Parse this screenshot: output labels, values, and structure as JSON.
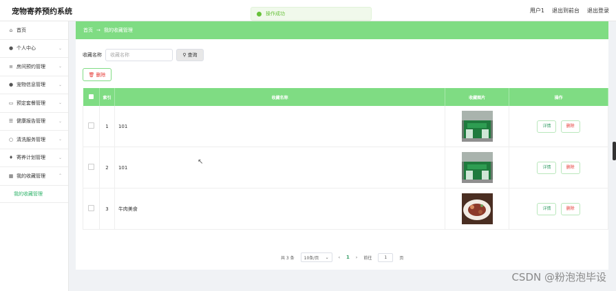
{
  "header": {
    "app_title": "宠物寄养预约系统",
    "user": "用户1",
    "back_to_front": "退出到前台",
    "logout": "退出登录"
  },
  "toast": {
    "message": "操作成功"
  },
  "sidebar": {
    "items": [
      {
        "label": "首页",
        "icon": "home-icon"
      },
      {
        "label": "个人中心",
        "icon": "user-icon"
      },
      {
        "label": "房间预约管理",
        "icon": "list-icon"
      },
      {
        "label": "宠物信息管理",
        "icon": "user-icon"
      },
      {
        "label": "预定套餐管理",
        "icon": "chat-icon"
      },
      {
        "label": "健康报告管理",
        "icon": "sliders-icon"
      },
      {
        "label": "清洗服务管理",
        "icon": "clock-icon"
      },
      {
        "label": "寄养计划管理",
        "icon": "location-icon"
      },
      {
        "label": "我的收藏管理",
        "icon": "grid-icon"
      }
    ],
    "sub_item": "我的收藏管理"
  },
  "breadcrumb": {
    "home": "首页",
    "arrow": "→",
    "current": "我的收藏管理"
  },
  "search": {
    "label": "收藏名称",
    "placeholder": "收藏名称",
    "button": "查询"
  },
  "toolbar": {
    "delete_label": "删除"
  },
  "table": {
    "headers": {
      "index": "索引",
      "name": "收藏名称",
      "image": "收藏图片",
      "ops": "操作"
    },
    "rows": [
      {
        "index": "1",
        "name": "101",
        "image": "storefront"
      },
      {
        "index": "2",
        "name": "101",
        "image": "storefront"
      },
      {
        "index": "3",
        "name": "牛肉美食",
        "image": "food"
      }
    ],
    "detail_label": "详情",
    "delete_label": "删除"
  },
  "pagination": {
    "total": "共 3 条",
    "page_size": "10条/页",
    "prev": "‹",
    "current_page": "1",
    "next": "›",
    "goto_prefix": "前往",
    "goto_value": "1",
    "goto_suffix": "页"
  },
  "watermark": "CSDN @粉泡泡毕设",
  "colors": {
    "accent": "#7fdc83",
    "link": "#3aa06a",
    "danger": "#e53935"
  }
}
